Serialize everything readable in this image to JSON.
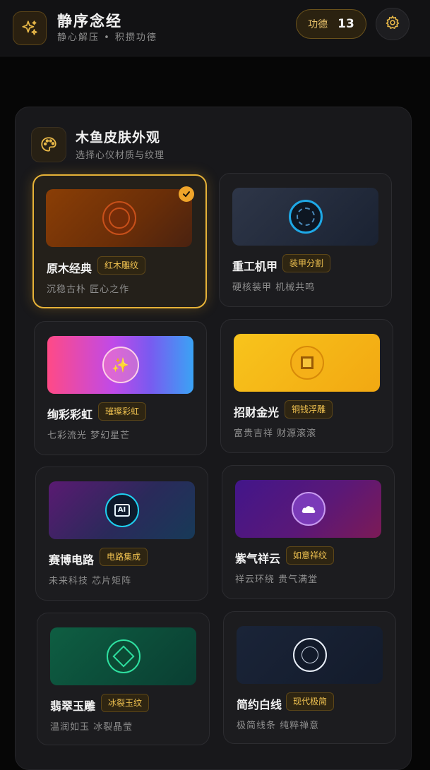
{
  "header": {
    "title": "静序念经",
    "subtitle": "静心解压 • 积攒功德",
    "merit_label": "功德",
    "merit_count": "13",
    "app_icon": "sparkle-icon",
    "settings_icon": "gear-icon"
  },
  "section": {
    "title": "木鱼皮肤外观",
    "subtitle": "选择心仪材质与纹理",
    "icon": "palette-icon"
  },
  "skins": [
    {
      "name": "原木经典",
      "tag": "红木雕纹",
      "desc": "沉稳古朴 匠心之作",
      "selected": true,
      "icon": "wood-ring-icon",
      "colors": [
        "#8a3a08",
        "#5a2a0a"
      ]
    },
    {
      "name": "重工机甲",
      "tag": "装甲分割",
      "desc": "硬核装甲 机械共鸣",
      "selected": false,
      "icon": "mech-ring-icon",
      "colors": [
        "#2c3446",
        "#1a2232"
      ]
    },
    {
      "name": "绚彩彩虹",
      "tag": "璀璨彩虹",
      "desc": "七彩流光 梦幻星芒",
      "selected": false,
      "icon": "sparkles-icon",
      "colors": [
        "#ff4a86",
        "#b04bf2",
        "#3aa3f5"
      ]
    },
    {
      "name": "招财金光",
      "tag": "铜钱浮雕",
      "desc": "富贵吉祥 财源滚滚",
      "selected": false,
      "icon": "coin-icon",
      "colors": [
        "#f7c21a",
        "#f09a10"
      ]
    },
    {
      "name": "赛博电路",
      "tag": "电路集成",
      "desc": "未来科技 芯片矩阵",
      "selected": false,
      "icon": "ai-chip-icon",
      "icon_text": "AI",
      "colors": [
        "#5a1a70",
        "#1a3a5a"
      ]
    },
    {
      "name": "紫气祥云",
      "tag": "如意祥纹",
      "desc": "祥云环绕 贵气满堂",
      "selected": false,
      "icon": "cloud-icon",
      "colors": [
        "#46148c",
        "#8c1a5c"
      ]
    },
    {
      "name": "翡翠玉雕",
      "tag": "冰裂玉纹",
      "desc": "温润如玉 冰裂晶莹",
      "selected": false,
      "icon": "jade-diamond-icon",
      "colors": [
        "#0e5a40",
        "#0a3a30"
      ]
    },
    {
      "name": "简约白线",
      "tag": "现代极简",
      "desc": "极简线条 纯粹禅意",
      "selected": false,
      "icon": "white-ring-icon",
      "colors": [
        "#1a2438",
        "#121a2a"
      ]
    }
  ]
}
